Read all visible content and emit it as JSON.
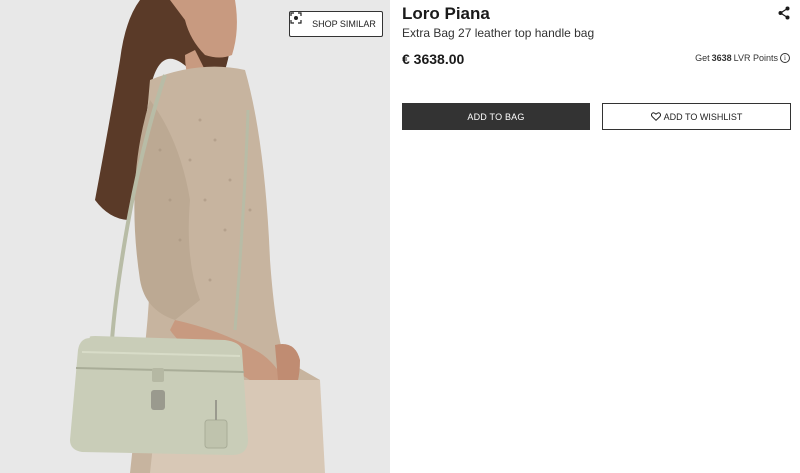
{
  "image": {
    "shop_similar_label": "SHOP SIMILAR",
    "icon": "scan-icon"
  },
  "product": {
    "brand": "Loro Piana",
    "name": "Extra Bag 27 leather top handle bag",
    "price": "€ 3638.00",
    "points_prefix": "Get",
    "points_value": "3638",
    "points_suffix": "LVR Points",
    "share_icon": "share-icon",
    "info_icon": "info-icon"
  },
  "actions": {
    "add_to_bag": "ADD TO BAG",
    "add_to_wishlist": "ADD TO WISHLIST",
    "wishlist_icon": "heart-icon"
  },
  "colors": {
    "primary_button": "#333333",
    "background_image": "#e9e9e9",
    "bag": "#c9cdb8"
  }
}
